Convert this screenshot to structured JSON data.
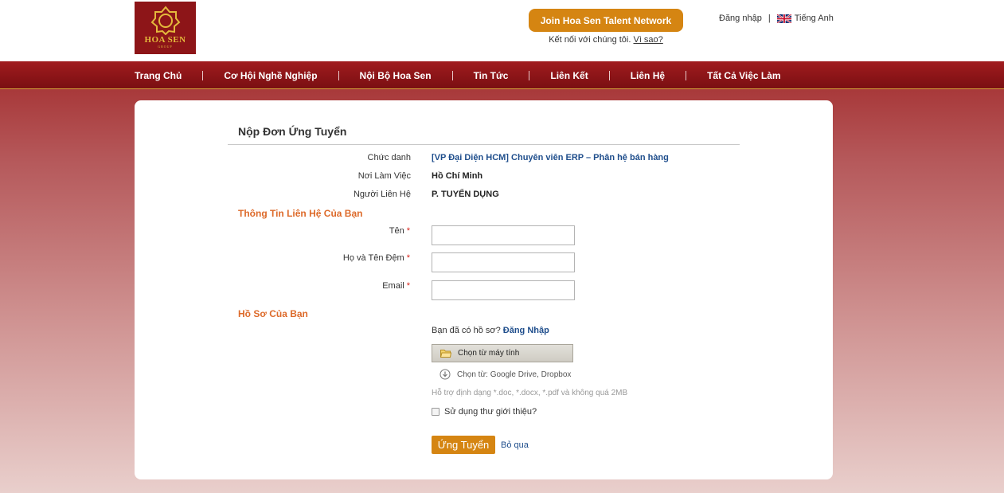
{
  "header": {
    "logo_text": "HOA SEN",
    "logo_subtext": "GROUP",
    "join_button": "Join Hoa Sen Talent Network",
    "connect_text": "Kết nối với chúng tôi.",
    "connect_link": "Vì sao?",
    "login_link": "Đăng nhập",
    "separator": "|",
    "language": "Tiếng Anh",
    "language_flag_icon": "uk-flag-icon"
  },
  "nav": {
    "items": [
      "Trang Chủ",
      "Cơ Hội Nghề Nghiệp",
      "Nội Bộ Hoa Sen",
      "Tin Tức",
      "Liên Kết",
      "Liên Hệ",
      "Tất Cả Việc Làm"
    ]
  },
  "form": {
    "title": "Nộp Đơn Ứng Tuyển",
    "job": {
      "title_label": "Chức danh",
      "title_value": "[VP Đại Diện HCM] Chuyên viên ERP – Phân hệ bán hàng",
      "location_label": "Nơi Làm Việc",
      "location_value": "Hồ Chí Minh",
      "contact_label": "Người Liên Hệ",
      "contact_value": "P. TUYỂN DỤNG"
    },
    "contact_section": "Thông Tin Liên Hệ Của Bạn",
    "required_mark": "*",
    "fields": {
      "first_name_label": "Tên",
      "first_name_value": "",
      "last_name_label": "Họ và Tên Đệm",
      "last_name_value": "",
      "email_label": "Email",
      "email_value": ""
    },
    "profile_section": "Hồ Sơ Của Bạn",
    "have_profile_text": "Bạn đã có hồ sơ?",
    "have_profile_login": "Đăng Nhập",
    "choose_computer": "Chọn từ máy tính",
    "choose_cloud": "Chọn từ: Google Drive, Dropbox",
    "support_note": "Hỗ trợ định dạng *.doc, *.docx, *.pdf và không quá 2MB",
    "cover_letter_checkbox": "Sử dụng thư giới thiệu?",
    "cover_letter_checked": false,
    "submit_button": "Ứng Tuyển",
    "skip_link": "Bỏ qua"
  },
  "colors": {
    "brand_red": "#8d1518",
    "accent_orange": "#d58512",
    "section_orange": "#dd6a2a",
    "link_blue": "#1f4e8c"
  }
}
